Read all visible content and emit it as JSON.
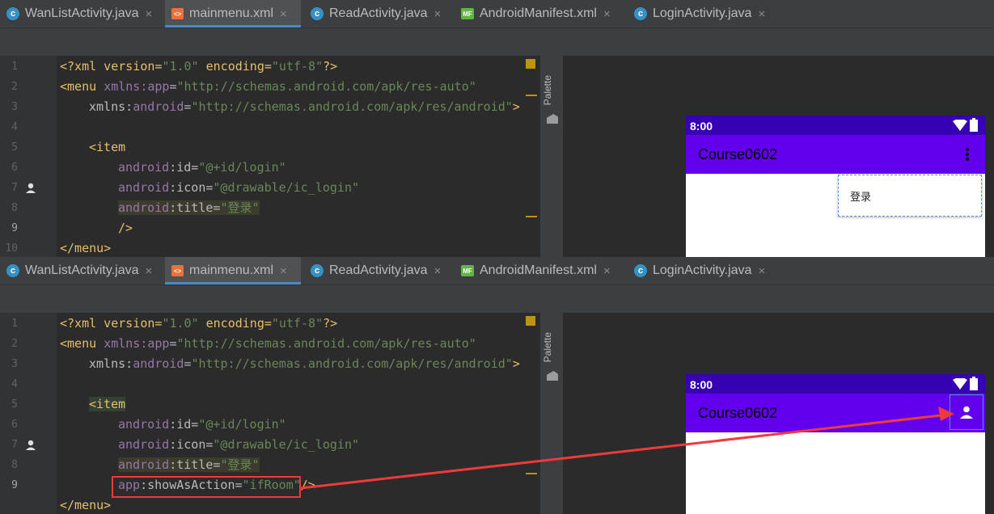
{
  "tabs": [
    {
      "label": "WanListActivity.java",
      "icon": "c",
      "active": false
    },
    {
      "label": "mainmenu.xml",
      "icon": "xml",
      "active": true
    },
    {
      "label": "ReadActivity.java",
      "icon": "c",
      "active": false
    },
    {
      "label": "AndroidManifest.xml",
      "icon": "mf",
      "active": false
    },
    {
      "label": "LoginActivity.java",
      "icon": "c",
      "active": false
    }
  ],
  "tab_close": "×",
  "line_numbers": [
    "1",
    "2",
    "3",
    "4",
    "5",
    "6",
    "7",
    "8",
    "9",
    "10"
  ],
  "code": {
    "l1": {
      "a": "<?xml version=",
      "b": "\"1.0\"",
      "c": " encoding=",
      "d": "\"utf-8\"",
      "e": "?>"
    },
    "l2": {
      "a": "<menu ",
      "b": "xmlns:",
      "c": "app",
      "d": "=",
      "e": "\"http://schemas.android.com/apk/res-auto\""
    },
    "l3": {
      "b": "xmlns:",
      "c": "android",
      "d": "=",
      "e": "\"http://schemas.android.com/apk/res/android\"",
      "f": ">"
    },
    "l5": {
      "a": "<item"
    },
    "l6": {
      "ns": "android",
      "attr": ":id=",
      "val": "\"@+id/login\""
    },
    "l7": {
      "ns": "android",
      "attr": ":icon=",
      "val": "\"@drawable/ic_login\""
    },
    "l8": {
      "ns": "android",
      "attr": ":title=",
      "val": "\"登录\""
    },
    "l9_top": {
      "a": "/>"
    },
    "l9_bottom": {
      "ns": "app",
      "attr": ":showAsAction=",
      "val": "\"ifRoom\"",
      "end": "/>"
    },
    "l10": {
      "a": "</menu>"
    }
  },
  "palette_label": "Palette",
  "phone": {
    "time": "8:00",
    "app_title": "Course0602",
    "menu_item": "登录"
  },
  "colors": {
    "status_bar": "#3700b3",
    "app_bar": "#6200ee",
    "annotation": "#f03a3a"
  }
}
